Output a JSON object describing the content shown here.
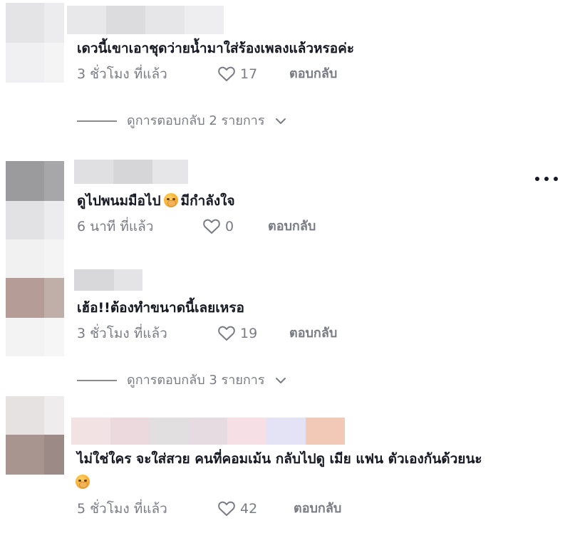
{
  "comments": [
    {
      "text": "เดวนี้เขาเอาชุดว่ายน้ำมาใส่ร้องเพลงแล้วหรอค่ะ",
      "time": "3 ชั่วโมง ที่แล้ว",
      "likes": "17",
      "reply": "ตอบกลับ",
      "view_replies": "ดูการตอบกลับ 2 รายการ"
    },
    {
      "text": "ดูไปพนมมือไป",
      "text_after": "มีกำลังใจ",
      "time": "6 นาที ที่แล้ว",
      "likes": "0",
      "reply": "ตอบกลับ"
    },
    {
      "text": "เฮ้อ!!ต้องทำขนาดนี้เลยเหรอ",
      "time": "3 ชั่วโมง ที่แล้ว",
      "likes": "19",
      "reply": "ตอบกลับ",
      "view_replies": "ดูการตอบกลับ 3 รายการ"
    },
    {
      "text": "ไม่ใช่ใคร จะใส่สวย คนที่คอมเม้น กลับไปดู เมีย แฟน ตัวเองกันด้วยนะ",
      "time": "5 ชั่วโมง ที่แล้ว",
      "likes": "42",
      "reply": "ตอบกลับ"
    }
  ],
  "icons": {
    "like": "heart-outline-icon",
    "more": "more-horizontal-icon",
    "chevron": "chevron-down-icon",
    "emoji": "praying-face-emoji"
  },
  "colors": {
    "text": "#161823",
    "muted": "#7a7c85",
    "line": "#8a8b91"
  }
}
